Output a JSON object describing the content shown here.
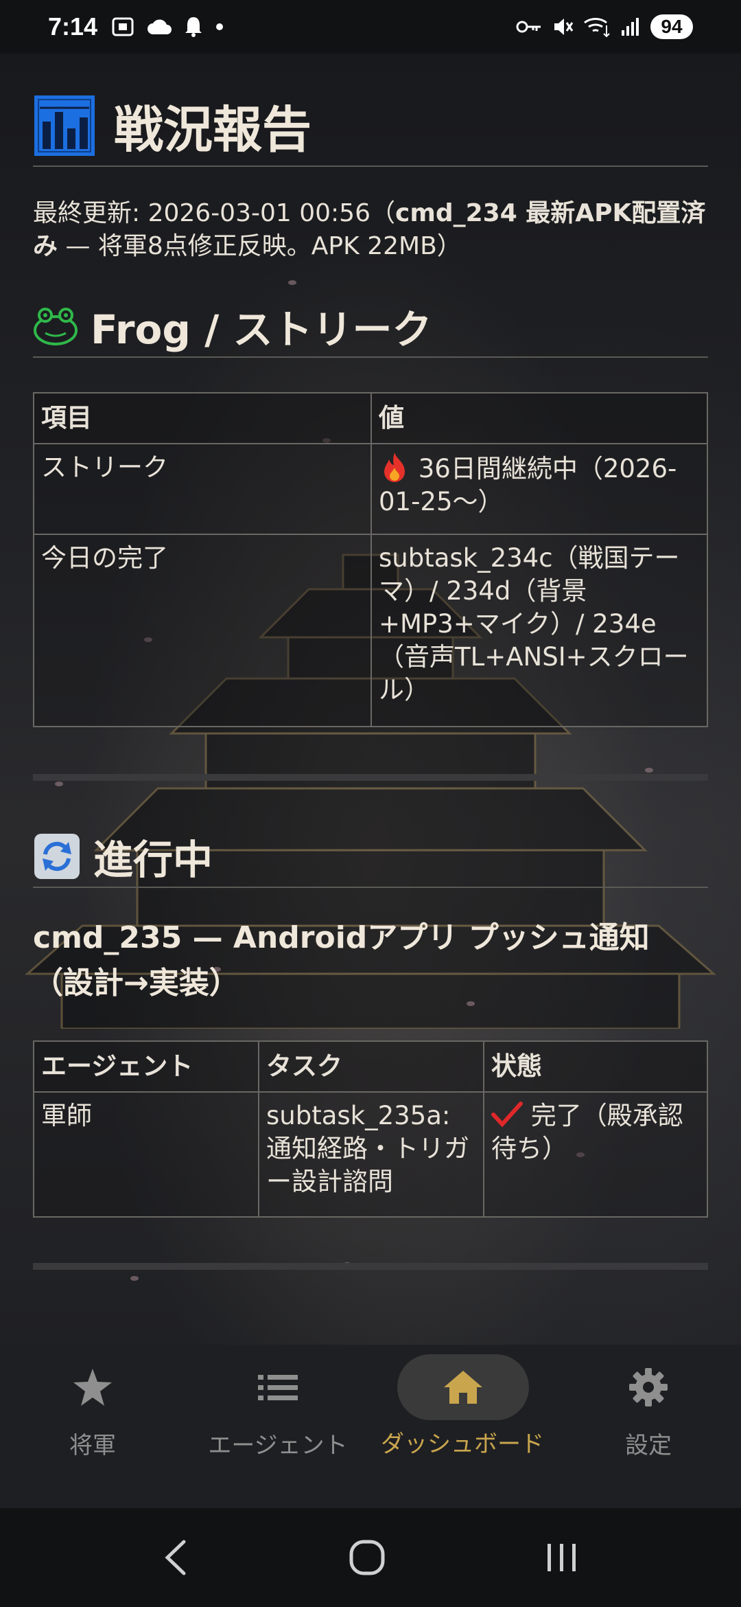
{
  "status_bar": {
    "time": "7:14",
    "battery": "94",
    "left_icons": [
      "screenshot-icon",
      "cloud-icon",
      "bell-icon",
      "dot-icon"
    ],
    "right_icons": [
      "key-icon",
      "mute-icon",
      "wifi-icon",
      "signal-icon"
    ]
  },
  "page": {
    "title": "戦況報告",
    "title_icon": "bar-chart-icon",
    "updated_prefix": "最終更新: 2026-03-01 00:56（",
    "updated_bold": "cmd_234 最新APK配置済み",
    "updated_suffix": " — 将軍8点修正反映。APK 22MB）"
  },
  "frog_section": {
    "icon": "frog-icon",
    "heading": "Frog / ストリーク",
    "headers": [
      "項目",
      "値"
    ],
    "rows": [
      {
        "label": "ストリーク",
        "icon": "fire-icon",
        "value": "36日間継続中（2026-01-25〜）"
      },
      {
        "label": "今日の完了",
        "value": "subtask_234c（戦国テーマ）/ 234d（背景+MP3+マイク）/ 234e（音声TL+ANSI+スクロール）"
      }
    ]
  },
  "progress_section": {
    "icon": "refresh-icon",
    "heading": "進行中",
    "task_title": "cmd_235 — Androidアプリ プッシュ通知（設計→実装）",
    "headers": [
      "エージェント",
      "タスク",
      "状態"
    ],
    "rows": [
      {
        "agent": "軍師",
        "task": "subtask_235a: 通知経路・トリガー設計諮問",
        "status_icon": "check-icon",
        "status": "完了（殿承認待ち）"
      }
    ]
  },
  "bottom_nav": {
    "items": [
      {
        "label": "将軍",
        "icon": "star-icon",
        "active": false
      },
      {
        "label": "エージェント",
        "icon": "list-icon",
        "active": false
      },
      {
        "label": "ダッシュボード",
        "icon": "home-icon",
        "active": true
      },
      {
        "label": "設定",
        "icon": "gear-icon",
        "active": false
      }
    ],
    "active_color": "#c9a64e"
  },
  "system_nav": [
    "back-icon",
    "home-circle-icon",
    "recents-icon"
  ]
}
